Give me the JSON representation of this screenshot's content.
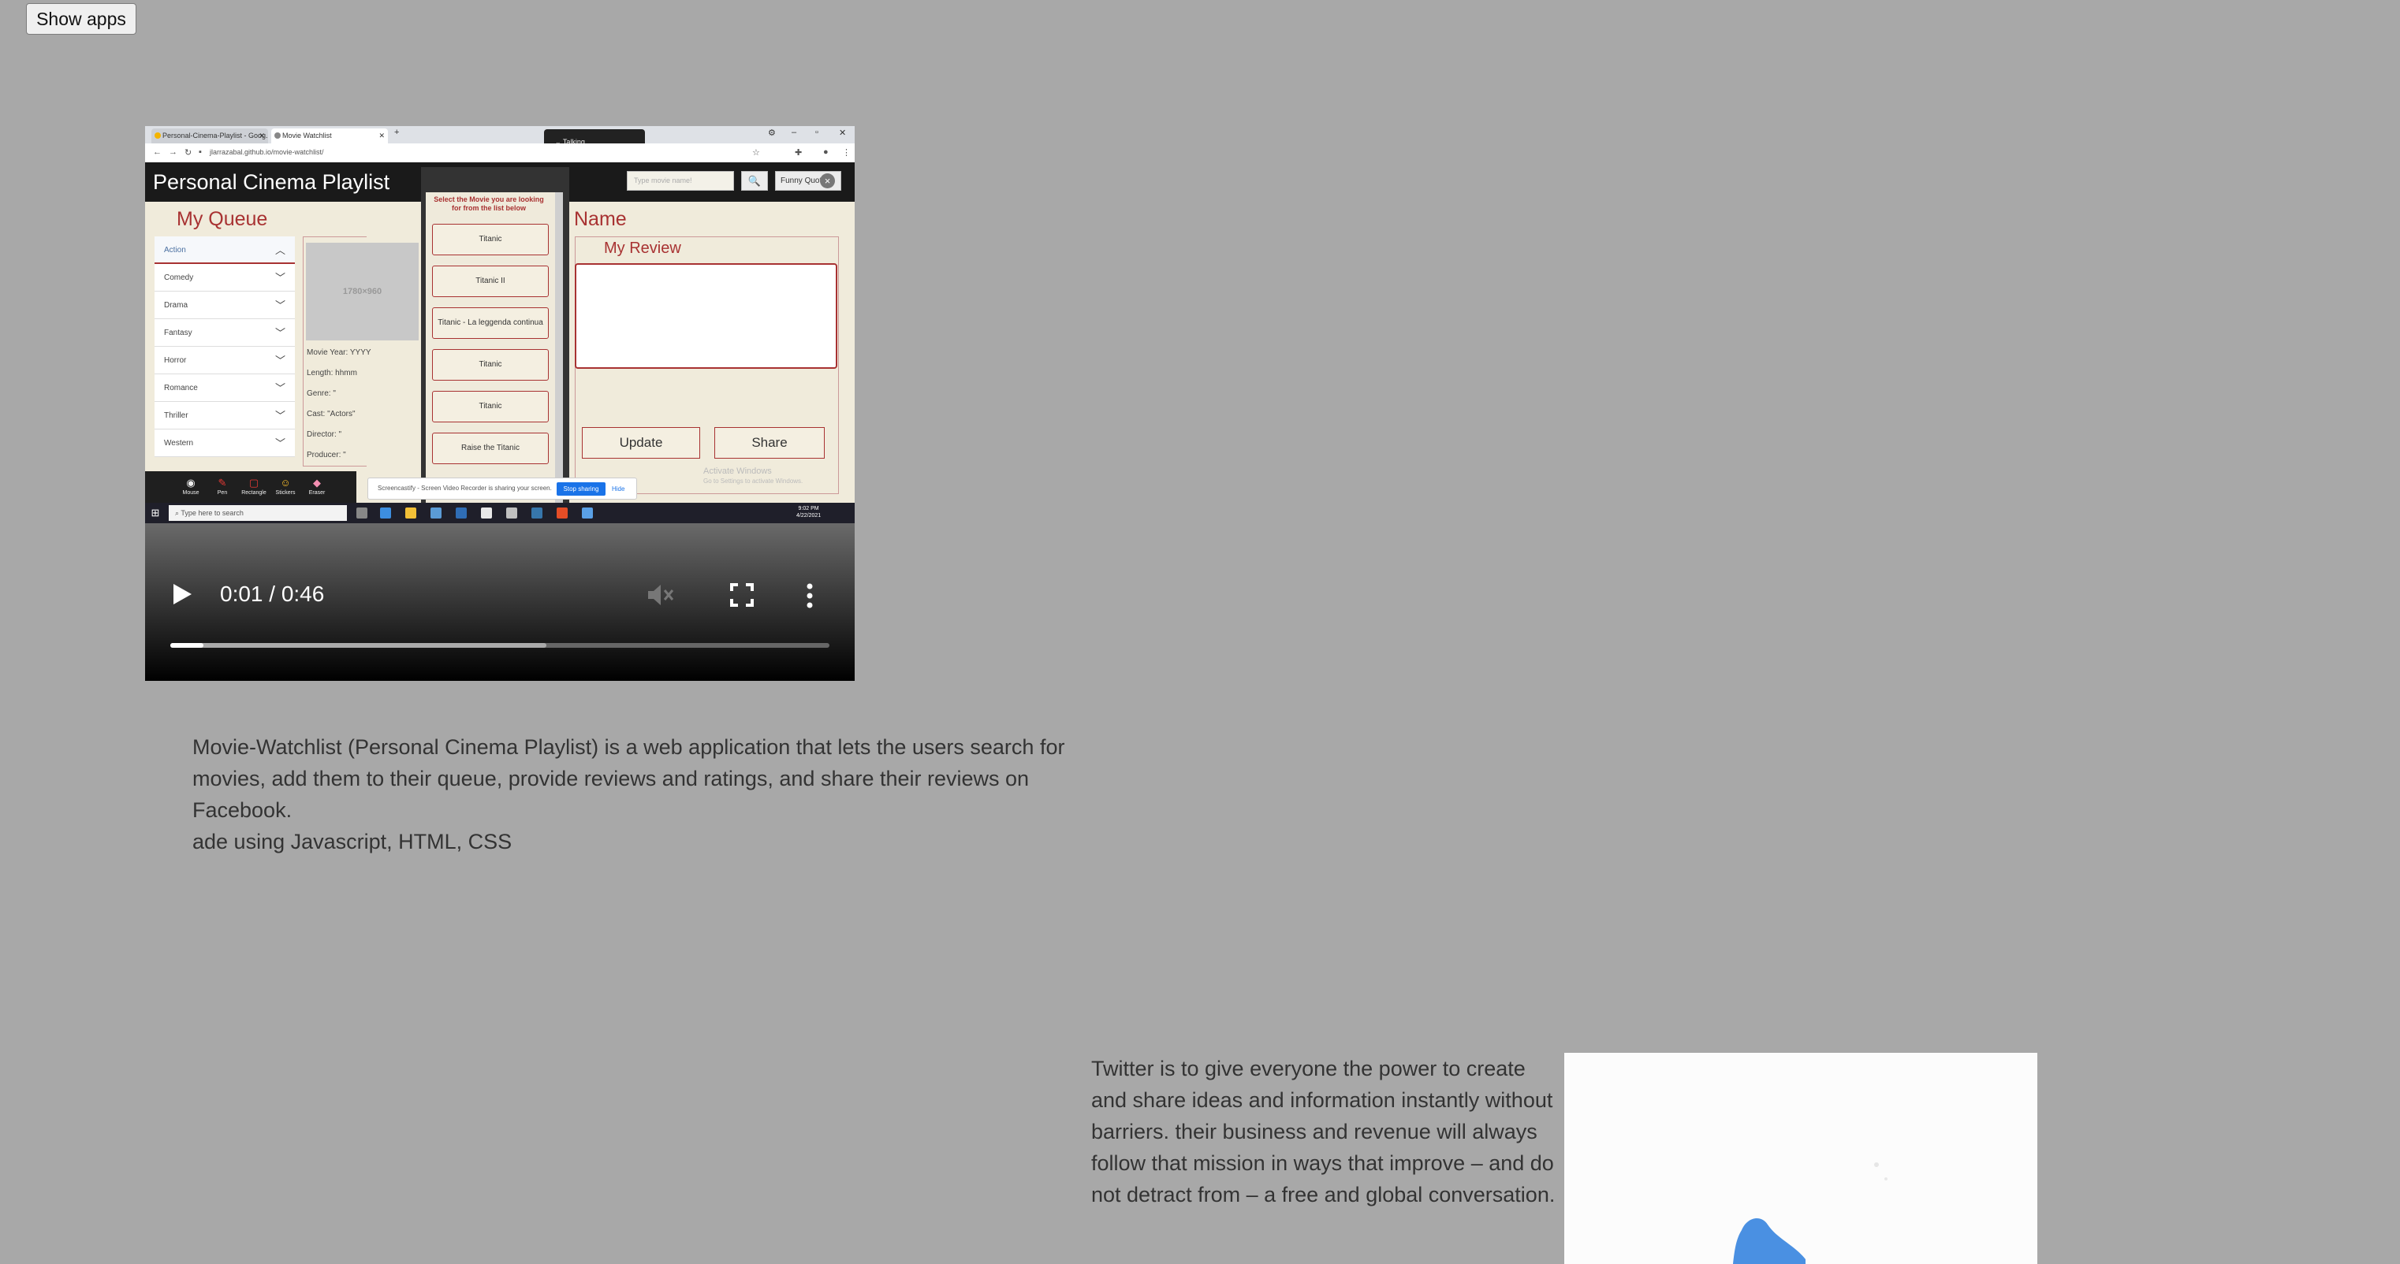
{
  "top": {
    "show_apps_label": "Show apps"
  },
  "video": {
    "current_time": "0:01",
    "duration": "0:46",
    "time_display": "0:01 / 0:46",
    "played_fraction": 0.05,
    "buffered_fraction": 0.57,
    "frame": {
      "browser": {
        "tabs": [
          "Personal-Cinema-Playlist - Goog...",
          "Movie Watchlist"
        ],
        "url": "jlarrazabal.github.io/movie-watchlist/",
        "talking_label": "Talking"
      },
      "app": {
        "title": "Personal Cinema Playlist",
        "search_placeholder": "Type movie name!",
        "funny_quote_label": "Funny Quote",
        "queue_title": "My Queue",
        "genres": [
          "Action",
          "Comedy",
          "Drama",
          "Fantasy",
          "Horror",
          "Romance",
          "Thriller",
          "Western"
        ],
        "poster_placeholder": "1780×960",
        "details": {
          "year": "Movie Year: YYYY",
          "length": "Length: hhmm",
          "genre": "Genre: \"",
          "cast": "Cast: \"Actors\"",
          "director": "Director: \"",
          "producer": "Producer: \""
        },
        "select_note": "Select the Movie you are looking for from the list below",
        "movie_options": [
          "Titanic",
          "Titanic II",
          "Titanic - La leggenda continua",
          "Titanic",
          "Titanic",
          "Raise the Titanic"
        ],
        "name_title": "Name",
        "review_title": "My Review",
        "update_label": "Update",
        "share_label": "Share",
        "activate_line1": "Activate Windows",
        "activate_line2": "Go to Settings to activate Windows."
      },
      "annotation_tools": [
        "Mouse",
        "Pen",
        "Rectangle",
        "Stickers",
        "Eraser"
      ],
      "share_banner": "Screencastify - Screen Video Recorder is sharing your screen.",
      "stop_sharing": "Stop sharing",
      "hide": "Hide",
      "taskbar": {
        "search_text": "Type here to search",
        "clock_time": "9:02 PM",
        "clock_date": "4/22/2021"
      }
    }
  },
  "description": {
    "line1": "Movie-Watchlist (Personal Cinema Playlist) is a web application that lets the users search for movies, add them to their queue, provide reviews and ratings, and share their reviews on Facebook.",
    "line2": "ade using Javascript, HTML, CSS"
  },
  "twitter": {
    "text": "Twitter is to give everyone the power to create and share ideas and information instantly without barriers. their business and revenue will always follow that mission in ways that improve – and do not detract from – a free and global conversation."
  },
  "colors": {
    "accent": "#a83232",
    "page_bg": "#a8a8a8",
    "header_bg": "#1a1a1a",
    "twitter_blue": "#1da1f2"
  }
}
